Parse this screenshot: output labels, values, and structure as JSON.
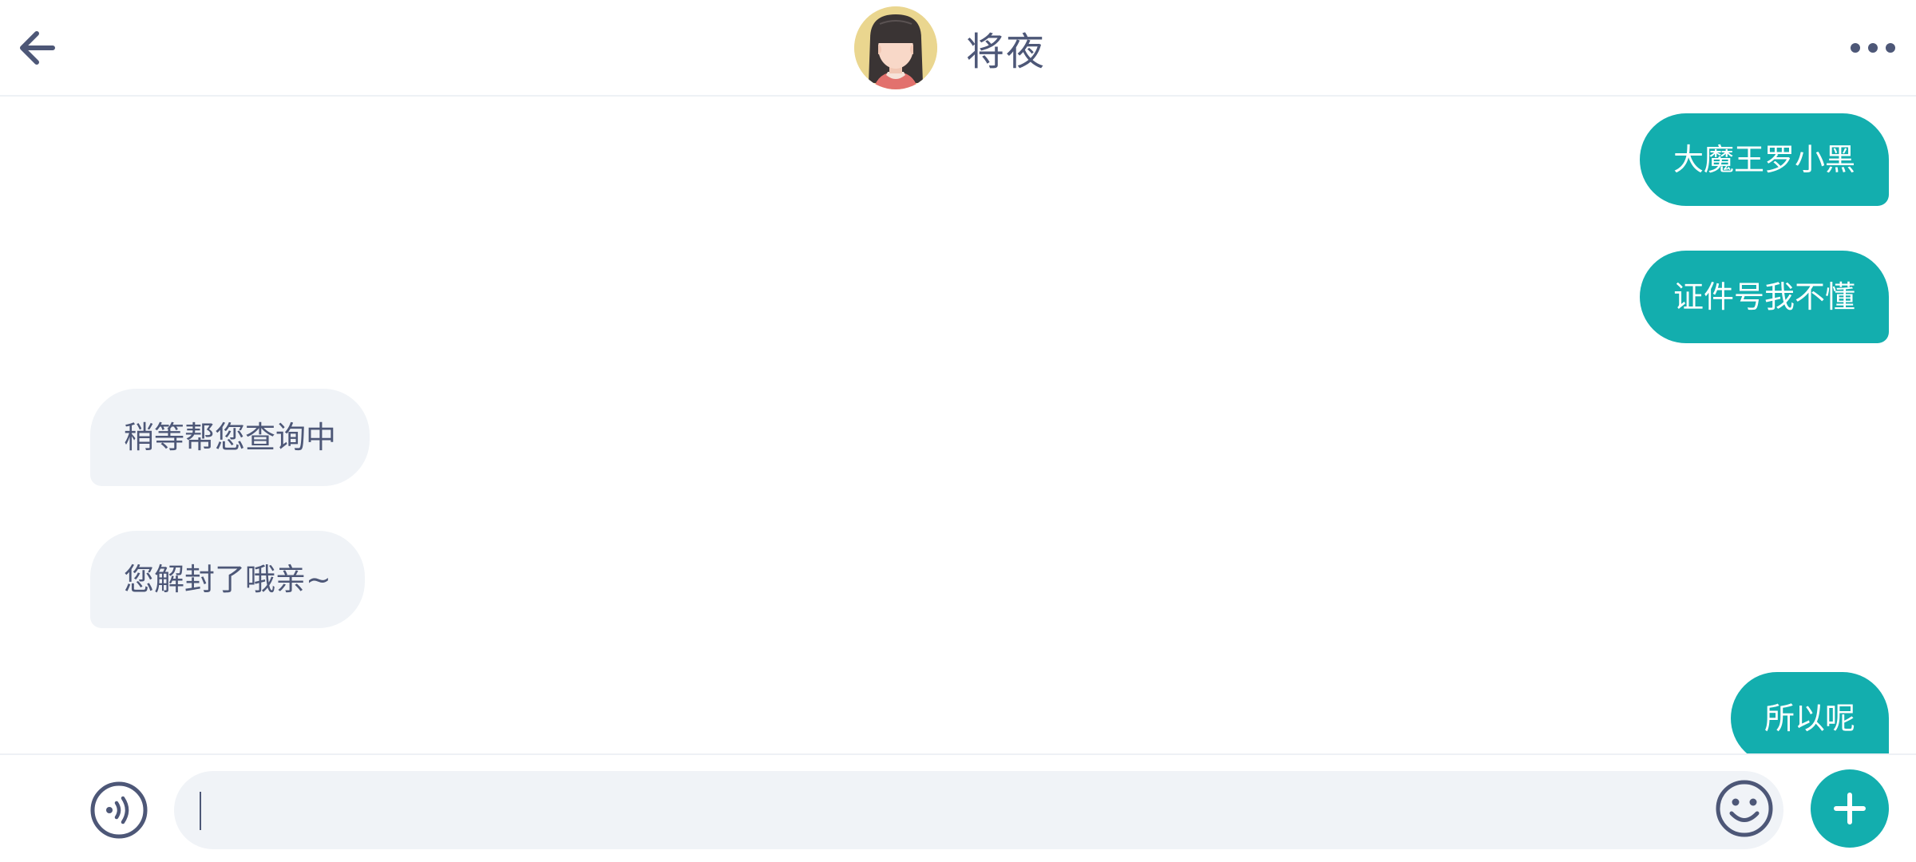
{
  "header": {
    "back_icon": "arrow-left-icon",
    "contact_name": "将夜",
    "avatar_icon": "girl-avatar",
    "more_icon": "ellipsis-icon"
  },
  "messages": [
    {
      "direction": "out",
      "text": "大魔王罗小黑"
    },
    {
      "direction": "out",
      "text": "证件号我不懂"
    },
    {
      "direction": "in",
      "text": "稍等帮您查询中"
    },
    {
      "direction": "in",
      "text": "您解封了哦亲~"
    },
    {
      "direction": "out",
      "text": "所以呢"
    }
  ],
  "input_bar": {
    "voice_icon": "voice-icon",
    "text_value": "",
    "placeholder": "",
    "emoji_icon": "smiley-icon",
    "plus_icon": "plus-icon"
  },
  "colors": {
    "accent": "#13aeae",
    "incoming_bubble": "#f0f3f7",
    "text_dark": "#4d5777",
    "avatar_bg": "#ead68f"
  }
}
